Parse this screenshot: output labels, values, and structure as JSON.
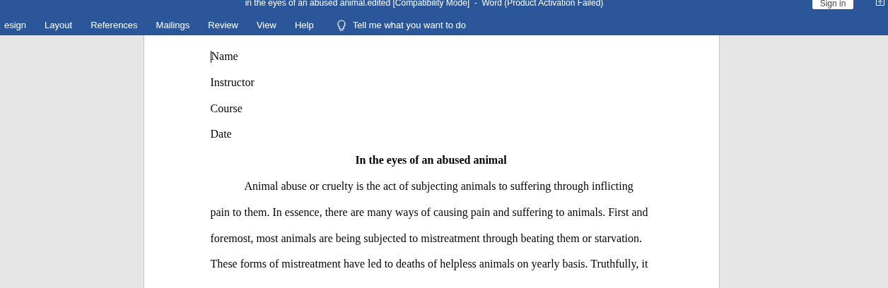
{
  "window": {
    "title": "in the eyes of an abused animal.edited [Compatibility Mode]  -  Word (Product Activation Failed)",
    "sign_in": "Sign in"
  },
  "ribbon_tabs": [
    {
      "label": "esign",
      "selected": false
    },
    {
      "label": "Layout",
      "selected": false
    },
    {
      "label": "References",
      "selected": false
    },
    {
      "label": "Mailings",
      "selected": false
    },
    {
      "label": "Review",
      "selected": false
    },
    {
      "label": "View",
      "selected": false
    },
    {
      "label": "Help",
      "selected": false
    }
  ],
  "tell_me": {
    "placeholder": "Tell me what you want to do"
  },
  "document": {
    "header_lines": [
      "Name",
      "Instructor",
      "Course",
      "Date"
    ],
    "heading": "In the eyes of an abused animal",
    "paragraph": "Animal abuse or cruelty is the act of subjecting animals to suffering through inflicting pain to them. In essence, there are many ways of causing pain and suffering to animals. First and foremost, most animals are being subjected to mistreatment through beating them or starvation. These forms of mistreatment have led to deaths of helpless animals on yearly basis. Truthfully, it"
  }
}
